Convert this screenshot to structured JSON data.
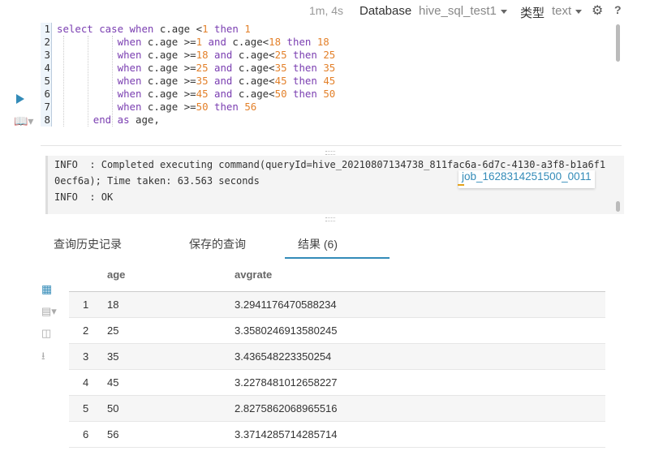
{
  "topbar": {
    "elapsed": "1m, 4s",
    "database_label": "Database",
    "database_value": "hive_sql_test1",
    "type_label": "类型",
    "type_value": "text",
    "settings_icon": "gear-icon",
    "help_label": "?"
  },
  "editor": {
    "lines": [
      {
        "n": "1",
        "tokens": [
          [
            "kw",
            "select "
          ],
          [
            "kw",
            "case "
          ],
          [
            "kw",
            "when "
          ],
          [
            "id",
            "c.age "
          ],
          [
            "id",
            "<"
          ],
          [
            "num",
            "1 "
          ],
          [
            "kw",
            "then "
          ],
          [
            "num",
            "1"
          ]
        ]
      },
      {
        "n": "2",
        "tokens": [
          [
            "id",
            "          "
          ],
          [
            "kw",
            "when "
          ],
          [
            "id",
            "c.age "
          ],
          [
            "id",
            ">="
          ],
          [
            "num",
            "1 "
          ],
          [
            "kw",
            "and "
          ],
          [
            "id",
            "c.age<"
          ],
          [
            "num",
            "18 "
          ],
          [
            "kw",
            "then "
          ],
          [
            "num",
            "18"
          ]
        ]
      },
      {
        "n": "3",
        "tokens": [
          [
            "id",
            "          "
          ],
          [
            "kw",
            "when "
          ],
          [
            "id",
            "c.age "
          ],
          [
            "id",
            ">="
          ],
          [
            "num",
            "18 "
          ],
          [
            "kw",
            "and "
          ],
          [
            "id",
            "c.age<"
          ],
          [
            "num",
            "25 "
          ],
          [
            "kw",
            "then "
          ],
          [
            "num",
            "25"
          ]
        ]
      },
      {
        "n": "4",
        "tokens": [
          [
            "id",
            "          "
          ],
          [
            "kw",
            "when "
          ],
          [
            "id",
            "c.age "
          ],
          [
            "id",
            ">="
          ],
          [
            "num",
            "25 "
          ],
          [
            "kw",
            "and "
          ],
          [
            "id",
            "c.age<"
          ],
          [
            "num",
            "35 "
          ],
          [
            "kw",
            "then "
          ],
          [
            "num",
            "35"
          ]
        ]
      },
      {
        "n": "5",
        "tokens": [
          [
            "id",
            "          "
          ],
          [
            "kw",
            "when "
          ],
          [
            "id",
            "c.age "
          ],
          [
            "id",
            ">="
          ],
          [
            "num",
            "35 "
          ],
          [
            "kw",
            "and "
          ],
          [
            "id",
            "c.age<"
          ],
          [
            "num",
            "45 "
          ],
          [
            "kw",
            "then "
          ],
          [
            "num",
            "45"
          ]
        ]
      },
      {
        "n": "6",
        "tokens": [
          [
            "id",
            "          "
          ],
          [
            "kw",
            "when "
          ],
          [
            "id",
            "c.age "
          ],
          [
            "id",
            ">="
          ],
          [
            "num",
            "45 "
          ],
          [
            "kw",
            "and "
          ],
          [
            "id",
            "c.age<"
          ],
          [
            "num",
            "50 "
          ],
          [
            "kw",
            "then "
          ],
          [
            "num",
            "50"
          ]
        ]
      },
      {
        "n": "7",
        "tokens": [
          [
            "id",
            "          "
          ],
          [
            "kw",
            "when "
          ],
          [
            "id",
            "c.age "
          ],
          [
            "id",
            ">="
          ],
          [
            "num",
            "50 "
          ],
          [
            "kw",
            "then "
          ],
          [
            "num",
            "56"
          ]
        ]
      },
      {
        "n": "8",
        "tokens": [
          [
            "id",
            "      "
          ],
          [
            "kw",
            "end "
          ],
          [
            "kw",
            "as "
          ],
          [
            "id",
            "age,"
          ]
        ]
      }
    ]
  },
  "log": {
    "line1": "INFO  : Completed executing command(queryId=hive_20210807134738_811fac6a-6d7c-4130-a3f8-b1a6f1",
    "line2": "0ecf6a); Time taken: 63.563 seconds",
    "line3": "INFO  : OK",
    "job_link": "job_1628314251500_0011"
  },
  "tabs": [
    {
      "label": "查询历史记录",
      "active": false
    },
    {
      "label": "保存的查询",
      "active": false
    },
    {
      "label": "结果 (6)",
      "active": true
    }
  ],
  "side_icons": [
    "grid-icon",
    "bar-chart-icon",
    "columns-icon",
    "download-icon"
  ],
  "results": {
    "columns": [
      "age",
      "avgrate"
    ],
    "rows": [
      [
        "1",
        "18",
        "3.2941176470588234"
      ],
      [
        "2",
        "25",
        "3.3580246913580245"
      ],
      [
        "3",
        "35",
        "3.436548223350254"
      ],
      [
        "4",
        "45",
        "3.2278481012658227"
      ],
      [
        "5",
        "50",
        "2.8275862068965516"
      ],
      [
        "6",
        "56",
        "3.3714285714285714"
      ]
    ]
  },
  "colors": {
    "accent": "#338bb8",
    "keyword": "#7a3eb1",
    "number": "#e3812b"
  }
}
